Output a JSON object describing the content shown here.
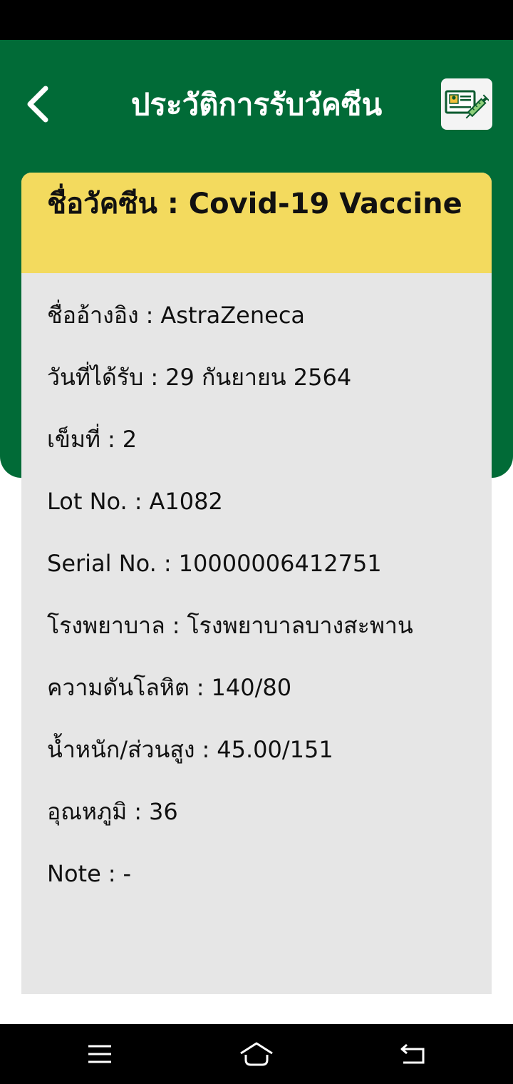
{
  "header": {
    "title": "ประวัติการรับวัคซีน"
  },
  "icons": {
    "back": "chevron-left-icon",
    "vaccine_card": "vaccine-certificate-syringe-icon",
    "nav_menu": "menu-icon",
    "nav_home": "home-icon",
    "nav_back": "back-icon"
  },
  "colors": {
    "header_green": "#016b37",
    "card_header_yellow": "#f3da5e",
    "card_body_gray": "#e6e6e6"
  },
  "card": {
    "title_label": "ชื่อวัคซีน",
    "title_value": "Covid-19 Vaccine",
    "fields": [
      {
        "label": "ชื่ออ้างอิง",
        "value": "AstraZeneca"
      },
      {
        "label": "วันที่ได้รับ",
        "value": "29 กันยายน 2564"
      },
      {
        "label": "เข็มที่",
        "value": "2"
      },
      {
        "label": "Lot No.",
        "value": "A1082"
      },
      {
        "label": "Serial No.",
        "value": "10000006412751"
      },
      {
        "label": "โรงพยาบาล",
        "value": "โรงพยาบาลบางสะพาน"
      },
      {
        "label": "ความดันโลหิต",
        "value": "140/80"
      },
      {
        "label": "น้ำหนัก/ส่วนสูง",
        "value": "45.00/151"
      },
      {
        "label": "อุณหภูมิ",
        "value": "36"
      },
      {
        "label": "Note",
        "value": "-"
      }
    ]
  }
}
